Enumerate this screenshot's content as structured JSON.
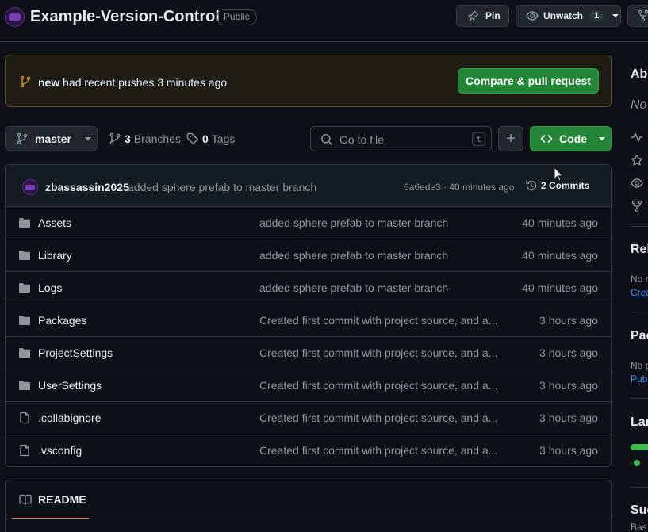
{
  "repo": {
    "name": "Example-Version-Control",
    "visibility": "Public"
  },
  "header": {
    "pin_label": "Pin",
    "unwatch_label": "Unwatch",
    "watch_count": "1"
  },
  "banner": {
    "branch": "new",
    "message": "had recent pushes 3 minutes ago",
    "button_label": "Compare & pull request"
  },
  "toolbar": {
    "branch": "master",
    "branches_count": "3",
    "branches_label": "Branches",
    "tags_count": "0",
    "tags_label": "Tags",
    "search_placeholder": "Go to file",
    "search_shortcut": "t",
    "add_label": "+",
    "code_label": "Code"
  },
  "commit": {
    "author": "zbassassin2025",
    "message": "added sphere prefab to master branch",
    "meta": "6a6ede3 · 40 minutes ago",
    "count_label": "2 Commits"
  },
  "files": [
    {
      "name": "Assets",
      "type": "folder",
      "message": "added sphere prefab to master branch",
      "time": "40 minutes ago"
    },
    {
      "name": "Library",
      "type": "folder",
      "message": "added sphere prefab to master branch",
      "time": "40 minutes ago"
    },
    {
      "name": "Logs",
      "type": "folder",
      "message": "added sphere prefab to master branch",
      "time": "40 minutes ago"
    },
    {
      "name": "Packages",
      "type": "folder",
      "message": "Created first commit with project source, and a...",
      "time": "3 hours ago"
    },
    {
      "name": "ProjectSettings",
      "type": "folder",
      "message": "Created first commit with project source, and a...",
      "time": "3 hours ago"
    },
    {
      "name": "UserSettings",
      "type": "folder",
      "message": "Created first commit with project source, and a...",
      "time": "3 hours ago"
    },
    {
      "name": ".collabignore",
      "type": "file",
      "message": "Created first commit with project source, and a...",
      "time": "3 hours ago"
    },
    {
      "name": ".vsconfig",
      "type": "file",
      "message": "Created first commit with project source, and a...",
      "time": "3 hours ago"
    }
  ],
  "readme": {
    "tab_label": "README"
  },
  "sidebar": {
    "about_heading": "Abo",
    "about_text": "No",
    "releases_heading": "Rel",
    "releases_text": "No r",
    "releases_link": "Crea",
    "packages_heading": "Pac",
    "packages_text": "No p",
    "packages_link": "Publ",
    "languages_heading": "Lan",
    "suggested_heading": "Sug",
    "suggested_text": "Bas"
  },
  "colors": {
    "accent_green": "#238636",
    "banner_bg": "#1f1c14",
    "banner_border": "#5a4a22",
    "link": "#4493f8",
    "readme_underline": "#f78166"
  }
}
